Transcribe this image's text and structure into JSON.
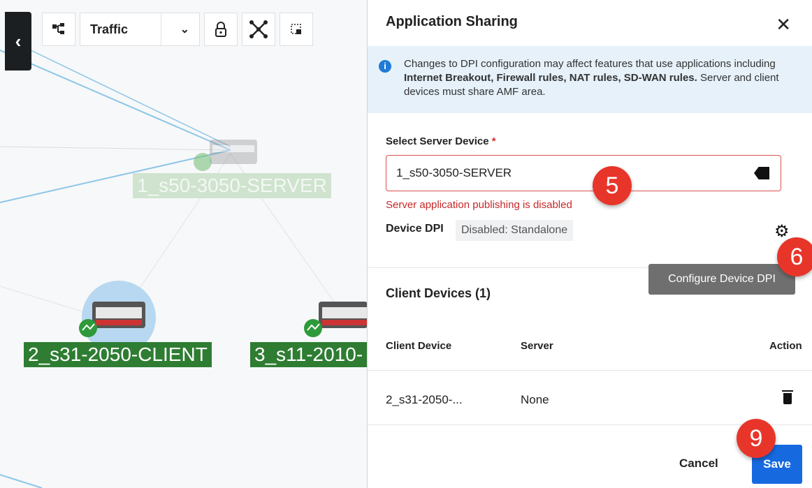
{
  "topology": {
    "view_select": "Traffic",
    "nodes": [
      {
        "label": "1_s50-3050-SERVER"
      },
      {
        "label": "2_s31-2050-CLIENT"
      },
      {
        "label": "3_s11-2010-"
      }
    ]
  },
  "panel": {
    "title": "Application Sharing",
    "info": {
      "line1": "Changes to DPI configuration may affect features that use applications including ",
      "bold": "Internet Breakout, Firewall rules, NAT rules, SD-WAN rules.",
      "line3": " Server and client devices must share AMF area."
    },
    "server_label": "Select Server Device",
    "required_mark": "*",
    "server_value": "1_s50-3050-SERVER",
    "error": "Server application publishing is disabled",
    "dpi_label": "Device DPI",
    "dpi_status": "Disabled: Standalone",
    "tooltip": "Configure Device DPI",
    "clients_title": "Client Devices (1)",
    "table": {
      "headers": [
        "Client Device",
        "Server",
        "Action"
      ],
      "rows": [
        {
          "client": "2_s31-2050-...",
          "server": "None"
        }
      ]
    },
    "cancel_label": "Cancel",
    "save_label": "Save"
  },
  "steps": [
    "5",
    "6",
    "9"
  ],
  "colors": {
    "accent": "#1769e0",
    "error": "#c62828",
    "node_green": "#2e7d32",
    "step_red": "#e8352a"
  }
}
